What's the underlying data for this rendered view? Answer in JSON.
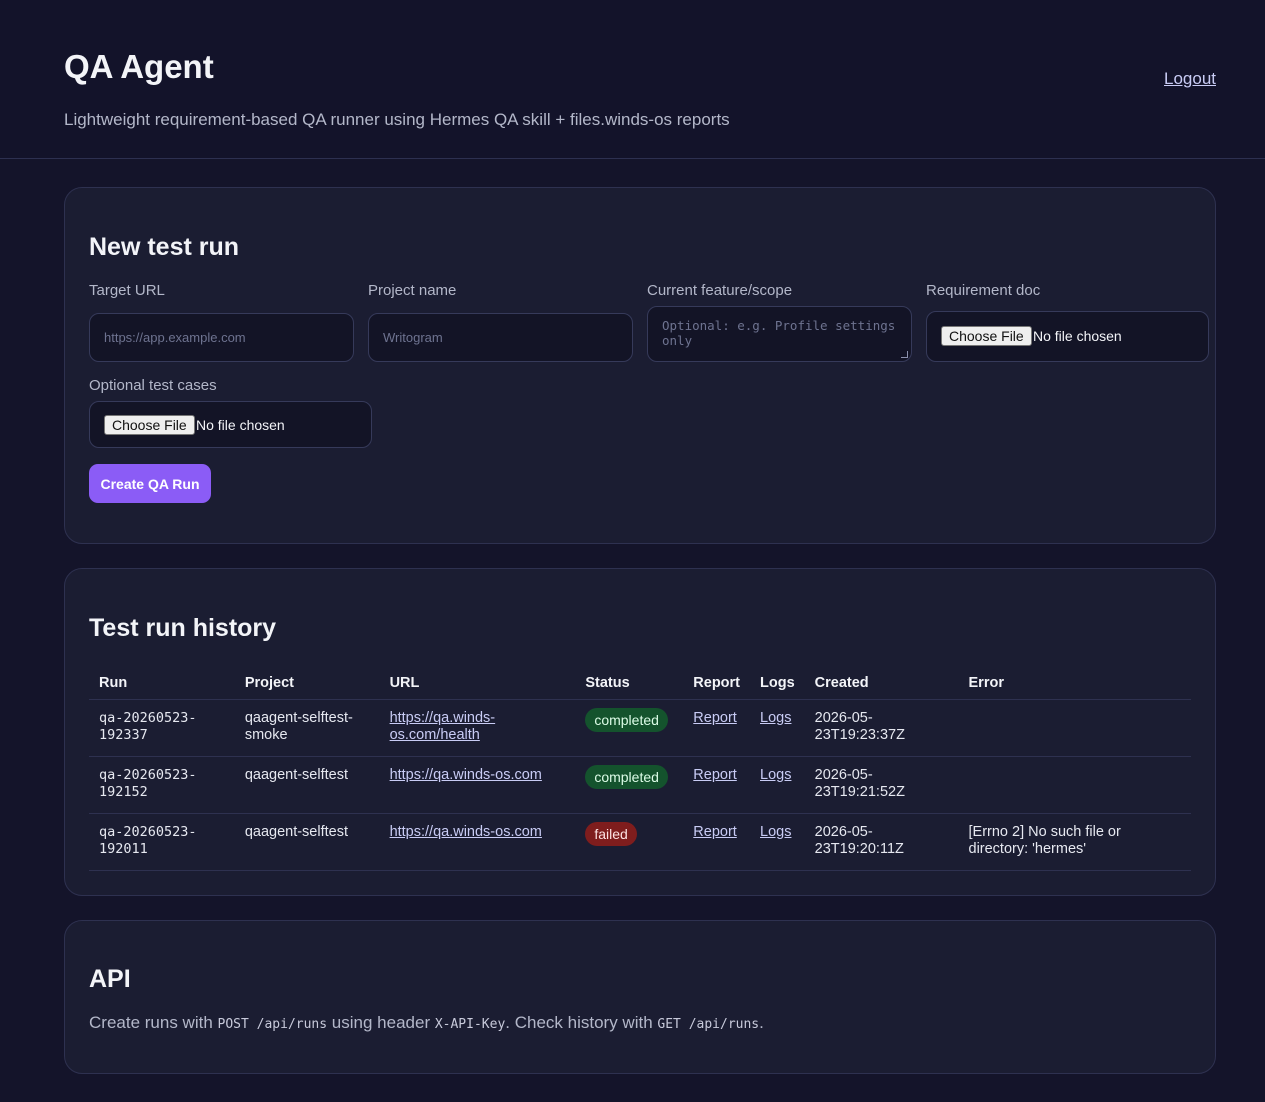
{
  "header": {
    "title": "QA Agent",
    "subtitle": "Lightweight requirement-based QA runner using Hermes QA skill + files.winds-os reports",
    "logout_label": "Logout"
  },
  "new_run": {
    "heading": "New test run",
    "target_url": {
      "label": "Target URL",
      "placeholder": "https://app.example.com"
    },
    "project_name": {
      "label": "Project name",
      "placeholder": "Writogram"
    },
    "feature_scope": {
      "label": "Current feature/scope",
      "placeholder": "Optional: e.g. Profile settings only"
    },
    "requirement_doc": {
      "label": "Requirement doc",
      "button": "Choose File",
      "status": "No file chosen"
    },
    "test_cases": {
      "label": "Optional test cases",
      "button": "Choose File",
      "status": "No file chosen"
    },
    "submit_label": "Create QA Run"
  },
  "history": {
    "heading": "Test run history",
    "columns": [
      "Run",
      "Project",
      "URL",
      "Status",
      "Report",
      "Logs",
      "Created",
      "Error"
    ],
    "rows": [
      {
        "run_line1": "qa-20260523-",
        "run_line2": "192337",
        "project_line1": "qaagent-selftest-",
        "project_line2": "smoke",
        "url_line1": "https://qa.winds-",
        "url_line2": "os.com/health",
        "status": "completed",
        "report": "Report",
        "logs": "Logs",
        "created_line1": "2026-05-",
        "created_line2": "23T19:23:37Z",
        "error_line1": "",
        "error_line2": ""
      },
      {
        "run_line1": "qa-20260523-",
        "run_line2": "192152",
        "project_line1": "qaagent-selftest",
        "project_line2": "",
        "url_line1": "https://qa.winds-os.com",
        "url_line2": "",
        "status": "completed",
        "report": "Report",
        "logs": "Logs",
        "created_line1": "2026-05-",
        "created_line2": "23T19:21:52Z",
        "error_line1": "",
        "error_line2": ""
      },
      {
        "run_line1": "qa-20260523-",
        "run_line2": "192011",
        "project_line1": "qaagent-selftest",
        "project_line2": "",
        "url_line1": "https://qa.winds-os.com",
        "url_line2": "",
        "status": "failed",
        "report": "Report",
        "logs": "Logs",
        "created_line1": "2026-05-",
        "created_line2": "23T19:20:11Z",
        "error_line1": "[Errno 2] No such file or",
        "error_line2": "directory: 'hermes'"
      }
    ]
  },
  "api": {
    "heading": "API",
    "text_1": "Create runs with ",
    "code_1": "POST /api/runs",
    "text_2": " using header ",
    "code_2": "X-API-Key",
    "text_3": ". Check history with ",
    "code_3": "GET /api/runs",
    "text_4": "."
  },
  "colors": {
    "background": "#14142a",
    "card": "#1b1d32",
    "accent": "#8b5cf6",
    "completed": "#14532d",
    "failed": "#7f1d1d"
  }
}
